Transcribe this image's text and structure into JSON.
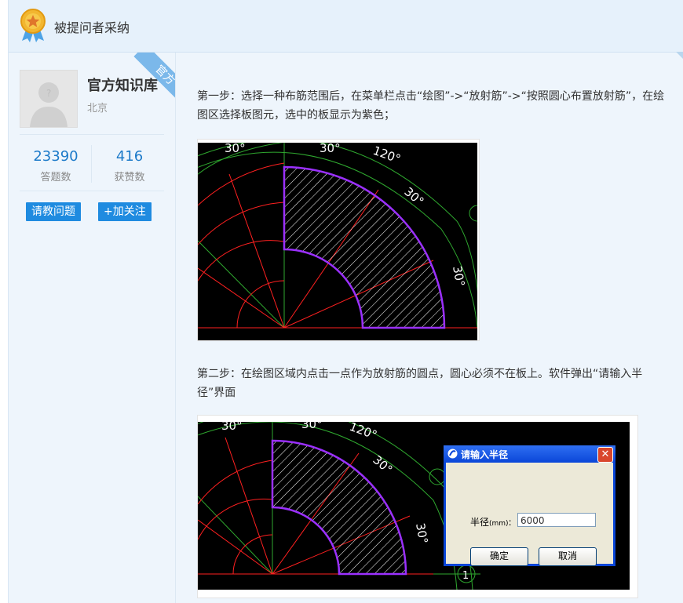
{
  "header": {
    "title": "被提问者采纳"
  },
  "profile": {
    "name": "官方知识库",
    "location": "北京",
    "ribbon": "官方",
    "stats": [
      {
        "value": "23390",
        "label": "答题数"
      },
      {
        "value": "416",
        "label": "获赞数"
      }
    ],
    "ask_button": "请教问题",
    "follow_button": "+加关注"
  },
  "answer": {
    "step1": "第一步：选择一种布筋范围后，在菜单栏点击“绘图”->“放射筋”->“按照圆心布置放射筋”，在绘图区选择板图元，选中的板显示为紫色；",
    "step2": "第二步：在绘图区域内点击一点作为放射筋的圆点，圆心必须不在板上。软件弹出“请输入半径”界面",
    "cad_labels": [
      "30°",
      "30°",
      "120°",
      "30°",
      "30°"
    ],
    "dialog": {
      "title": "请输入半径",
      "label": "半径",
      "unit": "(mm)",
      "colon": ":",
      "value": "6000",
      "ok": "确定",
      "cancel": "取消",
      "close": "✕"
    },
    "marker": "1"
  },
  "colors": {
    "accent": "#1f8be0",
    "purple": "#8a2be2",
    "red": "#ff2020",
    "green": "#2fa82f"
  }
}
